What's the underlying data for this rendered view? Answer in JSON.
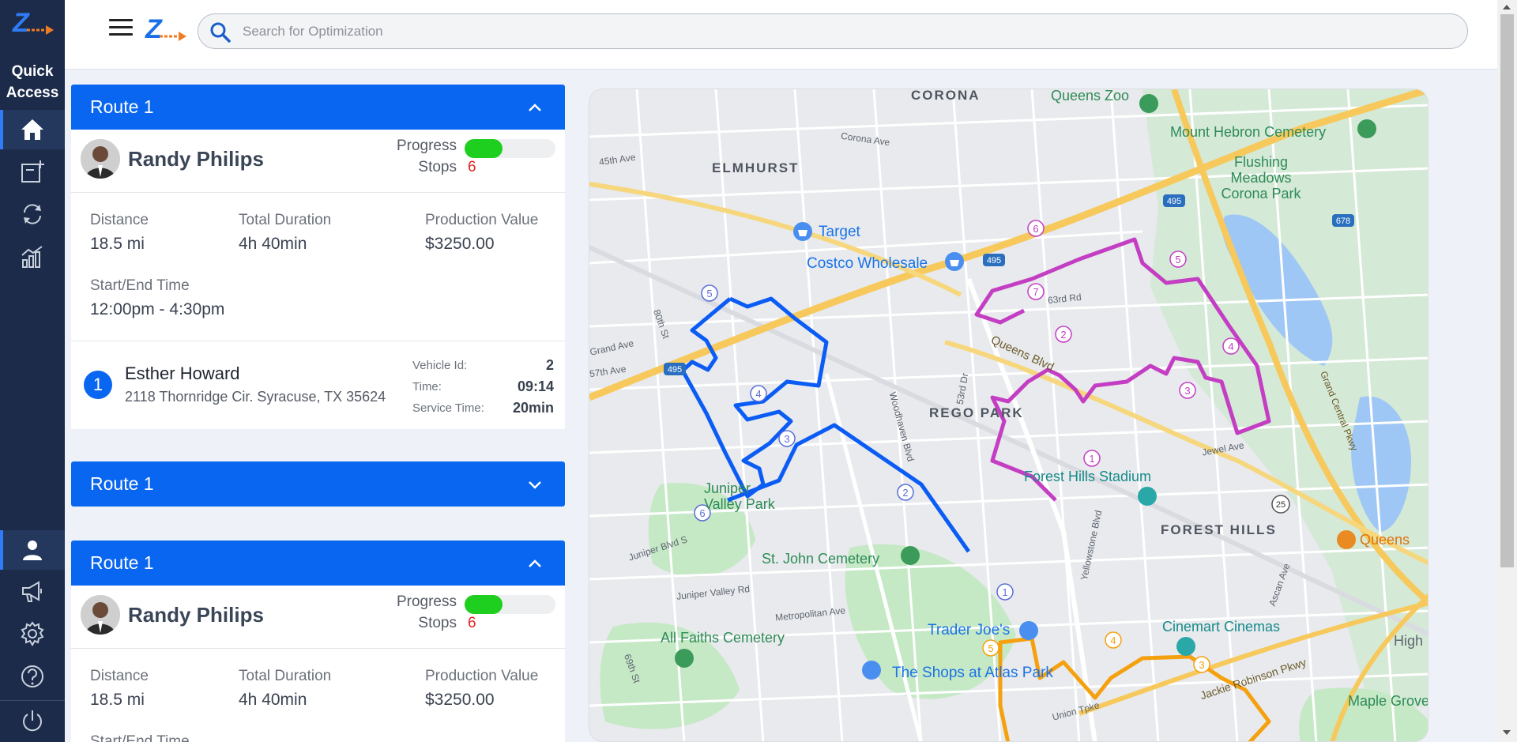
{
  "sidebar": {
    "quick_access": "Quick Access",
    "items": [
      {
        "icon": "home-icon"
      },
      {
        "icon": "add-note-icon"
      },
      {
        "icon": "sync-icon"
      },
      {
        "icon": "analytics-icon"
      },
      {
        "icon": "user-icon"
      },
      {
        "icon": "megaphone-icon"
      },
      {
        "icon": "gear-icon"
      },
      {
        "icon": "help-icon"
      },
      {
        "icon": "power-icon"
      }
    ]
  },
  "header": {
    "search_placeholder": "Search for Optimization"
  },
  "colors": {
    "primary": "#0866f0",
    "sidebar": "#1c2b4a",
    "progress": "#1fcf1f",
    "stops": "#e32222",
    "route_blue": "#0b5cf5",
    "route_magenta": "#c43ec3",
    "route_orange": "#f5a10f"
  },
  "routes": [
    {
      "title": "Route 1",
      "expanded": true,
      "driver": "Randy Philips",
      "progress_label": "Progress",
      "progress": 0.42,
      "stops_label": "Stops",
      "stops": "6",
      "distance_label": "Distance",
      "distance": "18.5 mi",
      "duration_label": "Total Duration",
      "duration": "4h 40min",
      "production_label": "Production Value",
      "production": "$3250.00",
      "time_label": "Start/End Time",
      "time": "12:00pm - 4:30pm",
      "stop": {
        "number": "1",
        "name": "Esther Howard",
        "address": "2118 Thornridge Cir. Syracuse, TX 35624",
        "vehicle_label": "Vehicle Id:",
        "vehicle": "2",
        "time_label": "Time:",
        "time": "09:14",
        "service_label": "Service Time:",
        "service": "20min"
      }
    },
    {
      "title": "Route 1",
      "expanded": false
    },
    {
      "title": "Route 1",
      "expanded": true,
      "driver": "Randy Philips",
      "progress_label": "Progress",
      "progress": 0.42,
      "stops_label": "Stops",
      "stops": "6",
      "distance_label": "Distance",
      "distance": "18.5 mi",
      "duration_label": "Total Duration",
      "duration": "4h 40min",
      "production_label": "Production Value",
      "production": "$3250.00",
      "time_label": "Start/End Time"
    }
  ],
  "map": {
    "areas": [
      "CORONA",
      "ELMHURST",
      "REGO PARK",
      "FOREST HILLS"
    ],
    "places": [
      "Queens Zoo",
      "Mount Hebron Cemetery",
      "Flushing Meadows Corona Park",
      "Target",
      "Costco Wholesale",
      "Forest Hills Stadium",
      "St. John Cemetery",
      "Juniper Valley Park",
      "All Faiths Cemetery",
      "Trader Joe's",
      "The Shops at Atlas Park",
      "Cinemart Cinemas",
      "Queens",
      "Maple Grove C",
      "High"
    ],
    "streets": [
      "Corona Ave",
      "45th Ave",
      "63rd Rd",
      "Queens Blvd",
      "Jewel Ave",
      "Woodhaven Blvd",
      "Grand Central Pkwy",
      "Juniper Valley Rd",
      "Metropolitan Ave",
      "Yellowstone Blvd",
      "Union Tpke",
      "Jackie Robinson Pkwy",
      "80th St",
      "69th St",
      "Juniper Blvd S",
      "Grand Ave",
      "57th Ave",
      "Ascan Ave",
      "53rd Dr"
    ],
    "highways": [
      "495",
      "678",
      "25"
    ],
    "blue_stops": [
      "1",
      "2",
      "3",
      "4",
      "5",
      "6"
    ],
    "magenta_stops": [
      "1",
      "2",
      "3",
      "4",
      "5",
      "6",
      "7"
    ],
    "orange_stops": [
      "3",
      "4",
      "5"
    ]
  }
}
